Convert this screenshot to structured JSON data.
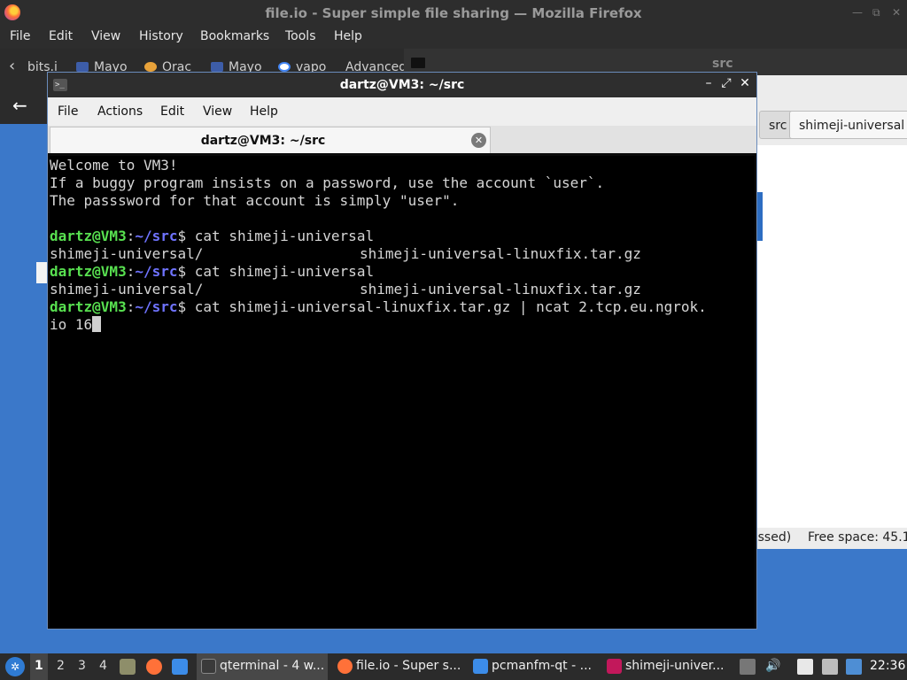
{
  "firefox": {
    "title": "file.io - Super simple file sharing — Mozilla Firefox",
    "window_buttons": [
      "—",
      "⧉",
      "✕"
    ],
    "menu": [
      "File",
      "Edit",
      "View",
      "History",
      "Bookmarks",
      "Tools",
      "Help"
    ],
    "bookmarks": [
      "bits.i",
      "Mayo",
      "Orac",
      "Mayo",
      "vapo",
      "Advanced"
    ],
    "back_label": "←",
    "bookmark_nav_label": "‹"
  },
  "filemanager": {
    "title": "src",
    "path_buttons": [
      "src",
      "shimeji-universal"
    ],
    "status_left": "essed)",
    "status_free": "Free space: 45.1"
  },
  "terminal": {
    "title": "dartz@VM3: ~/src",
    "icon_label": ">_",
    "buttons": [
      "–",
      "⤢",
      "✕"
    ],
    "menu": [
      "File",
      "Actions",
      "Edit",
      "View",
      "Help"
    ],
    "tab_title": "dartz@VM3: ~/src",
    "tab_close": "✕",
    "welcome": [
      "Welcome to VM3!",
      "If a buggy program insists on a password, use the account `user`.",
      "The passsword for that account is simply \"user\"."
    ],
    "prompt_user": "dartz@VM3",
    "prompt_colon": ":",
    "prompt_path": "~/src",
    "prompt_dollar": "$",
    "commands": [
      " cat shimeji-universal",
      " cat shimeji-universal",
      " cat shimeji-universal-linuxfix.tar.gz | ncat 2.tcp.eu.ngrok."
    ],
    "completions": [
      "shimeji-universal/",
      "shimeji-universal-linuxfix.tar.gz"
    ],
    "wrapped_line": "io 16"
  },
  "taskbar": {
    "start_glyph": "✲",
    "workspaces": [
      "1",
      "2",
      "3",
      "4"
    ],
    "tasks": [
      {
        "label": "qterminal - 4 w...",
        "color": "#3a3a3a"
      },
      {
        "label": "file.io - Super s...",
        "color": "#ff7139"
      },
      {
        "label": "pcmanfm-qt - ...",
        "color": "#3c8ce8"
      },
      {
        "label": "shimeji-univer...",
        "color": "#c2185b"
      }
    ],
    "clock": "22:36"
  }
}
